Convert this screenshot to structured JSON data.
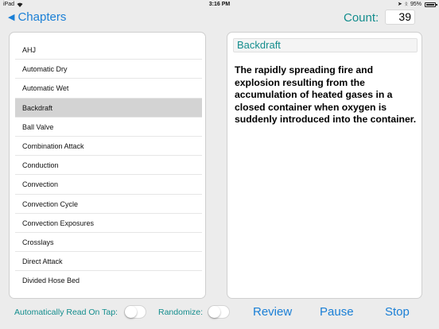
{
  "status_bar": {
    "device": "iPad",
    "time": "3:16 PM",
    "battery": "95%"
  },
  "nav": {
    "back_label": "Chapters",
    "count_label": "Count:",
    "count_value": "39"
  },
  "list": {
    "items": [
      "AHJ",
      "Automatic Dry",
      "Automatic Wet",
      "Backdraft",
      "Ball Valve",
      "Combination Attack",
      "Conduction",
      "Convection",
      "Convection Cycle",
      "Convection Exposures",
      "Crosslays",
      "Direct Attack",
      "Divided Hose Bed"
    ],
    "selected": "Backdraft"
  },
  "detail": {
    "title": "Backdraft",
    "definition": "The rapidly spreading fire and explosion resulting from the accumulation of heated gases in a closed container when oxygen is suddenly  introduced into the container."
  },
  "toolbar": {
    "auto_read_label": "Automatically Read On Tap:",
    "auto_read_on": false,
    "randomize_label": "Randomize:",
    "randomize_on": false,
    "review_label": "Review",
    "pause_label": "Pause",
    "stop_label": "Stop"
  },
  "colors": {
    "accent_blue": "#1a7fd6",
    "accent_teal": "#138d8d",
    "selected_row": "#d3d3d3"
  }
}
